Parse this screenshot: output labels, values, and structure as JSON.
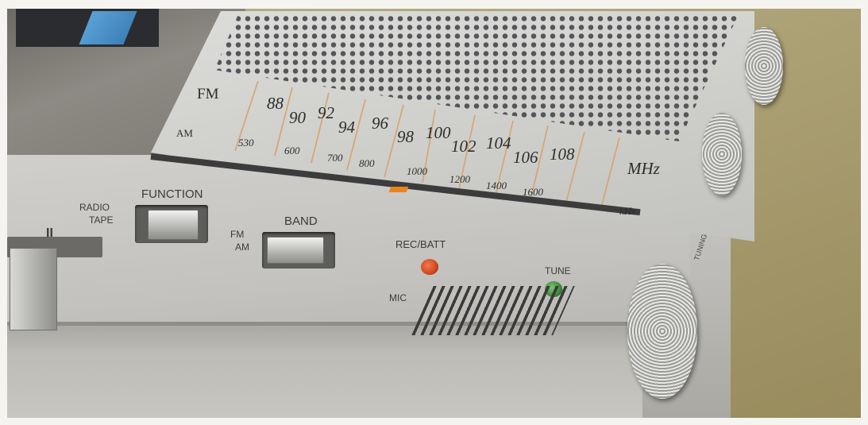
{
  "device": {
    "tuning_scale": {
      "fm_band_label": "FM",
      "am_band_label": "AM",
      "fm_unit": "MHz",
      "am_unit": "kHz",
      "fm_marks": [
        "88",
        "90",
        "92",
        "94",
        "96",
        "98",
        "100",
        "102",
        "104",
        "106",
        "108"
      ],
      "am_marks": [
        "530",
        "600",
        "700",
        "800",
        "1000",
        "1200",
        "1400",
        "1600"
      ],
      "pointer_color": "#e9841d"
    },
    "function_switch": {
      "label": "FUNCTION",
      "positions": [
        "RADIO",
        "TAPE"
      ]
    },
    "band_switch": {
      "label": "BAND",
      "positions": [
        "FM",
        "AM"
      ]
    },
    "indicators": {
      "rec_batt_label": "REC/BATT",
      "rec_batt_color": "#d2471f",
      "tune_label": "TUNE",
      "tune_color": "#3c8a3a"
    },
    "mic_label": "MIC",
    "pause_symbol": "II",
    "tuning_knob_label": "TUNING"
  }
}
